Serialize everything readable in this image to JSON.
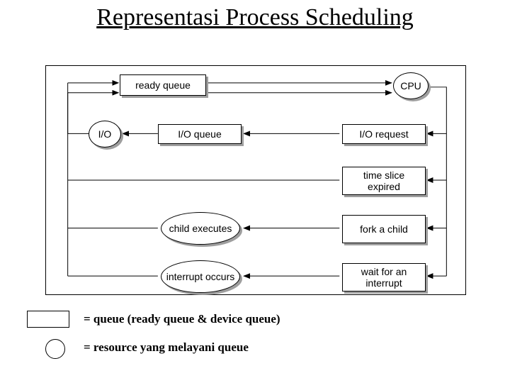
{
  "title": "Representasi Process Scheduling",
  "nodes": {
    "ready_queue": "ready queue",
    "cpu": "CPU",
    "io": "I/O",
    "io_queue": "I/O queue",
    "io_request": "I/O request",
    "time_slice": "time slice expired",
    "child_exec": "child executes",
    "fork_child": "fork a child",
    "interrupt_occurs": "interrupt occurs",
    "wait_interrupt": "wait for an interrupt"
  },
  "legend": {
    "queue": "= queue (ready queue & device queue)",
    "resource": "= resource yang melayani queue"
  }
}
